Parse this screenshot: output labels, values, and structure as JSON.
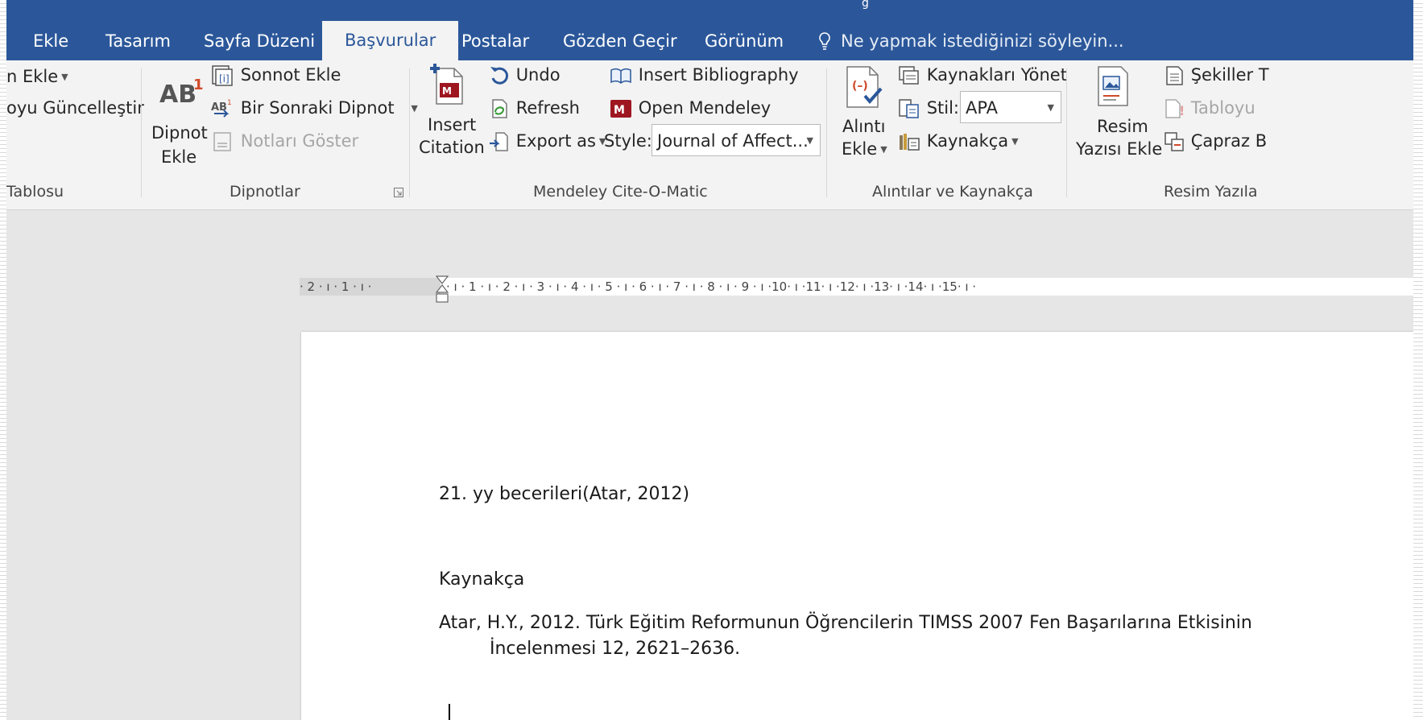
{
  "tabs": [
    {
      "label": "Ekle",
      "active": false
    },
    {
      "label": "Tasarım",
      "active": false
    },
    {
      "label": "Sayfa Düzeni",
      "active": false
    },
    {
      "label": "Başvurular",
      "active": true
    },
    {
      "label": "Postalar",
      "active": false
    },
    {
      "label": "Gözden Geçir",
      "active": false
    },
    {
      "label": "Görünüm",
      "active": false
    }
  ],
  "tell_me": "Ne yapmak istediğinizi söyleyin...",
  "ribbon": {
    "toc": {
      "add_text": "n Ekle",
      "update_table": "oyu Güncelleştir",
      "group_label": "Tablosu"
    },
    "footnotes": {
      "insert_footnote_line1": "Dipnot",
      "insert_footnote_line2": "Ekle",
      "insert_endnote": "Sonnot Ekle",
      "next_footnote": "Bir Sonraki Dipnot",
      "show_notes": "Notları Göster",
      "group_label": "Dipnotlar"
    },
    "mendeley": {
      "insert_citation_line1": "Insert",
      "insert_citation_line2": "Citation",
      "undo": "Undo",
      "refresh": "Refresh",
      "export_as": "Export as",
      "insert_bibliography": "Insert Bibliography",
      "open_mendeley": "Open Mendeley",
      "style_label": "Style:",
      "style_value": "Journal of Affect...",
      "group_label": "Mendeley Cite-O-Matic"
    },
    "citations": {
      "insert_citation_line1": "Alıntı",
      "insert_citation_line2": "Ekle",
      "manage_sources": "Kaynakları Yönet",
      "style_label": "Stil:",
      "style_value": "APA",
      "bibliography": "Kaynakça",
      "group_label": "Alıntılar ve Kaynakça"
    },
    "captions": {
      "insert_caption_line1": "Resim",
      "insert_caption_line2": "Yazısı Ekle",
      "table_of_figures": "Şekiller T",
      "update_table": "Tabloyu",
      "cross_reference": "Çapraz B",
      "group_label": "Resim Yazıla"
    }
  },
  "ruler": {
    "left_numbers": "· 2 · ı · 1 · ı ·",
    "right_numbers": "· ı · 1 · ı · 2 · ı · 3 · ı · 4 · ı · 5 · ı · 6 · ı · 7 · ı · 8 · ı · 9 · ı ·10· ı ·11· ı ·12· ı ·13· ı ·14· ı ·15· ı ·"
  },
  "document": {
    "line1": "21. yy becerileri(Atar, 2012)",
    "heading": "Kaynakça",
    "ref_line1": "Atar, H.Y., 2012. Türk Eğitim Reformunun Öğrencilerin TIMSS 2007 Fen Başarılarına Etkisinin",
    "ref_line2": "İncelenmesi 12, 2621–2636."
  },
  "colors": {
    "tab_bar": "#2b579a",
    "ribbon": "#f3f3f3",
    "workspace": "#e6e6e6",
    "mendeley_red": "#9d1620"
  }
}
